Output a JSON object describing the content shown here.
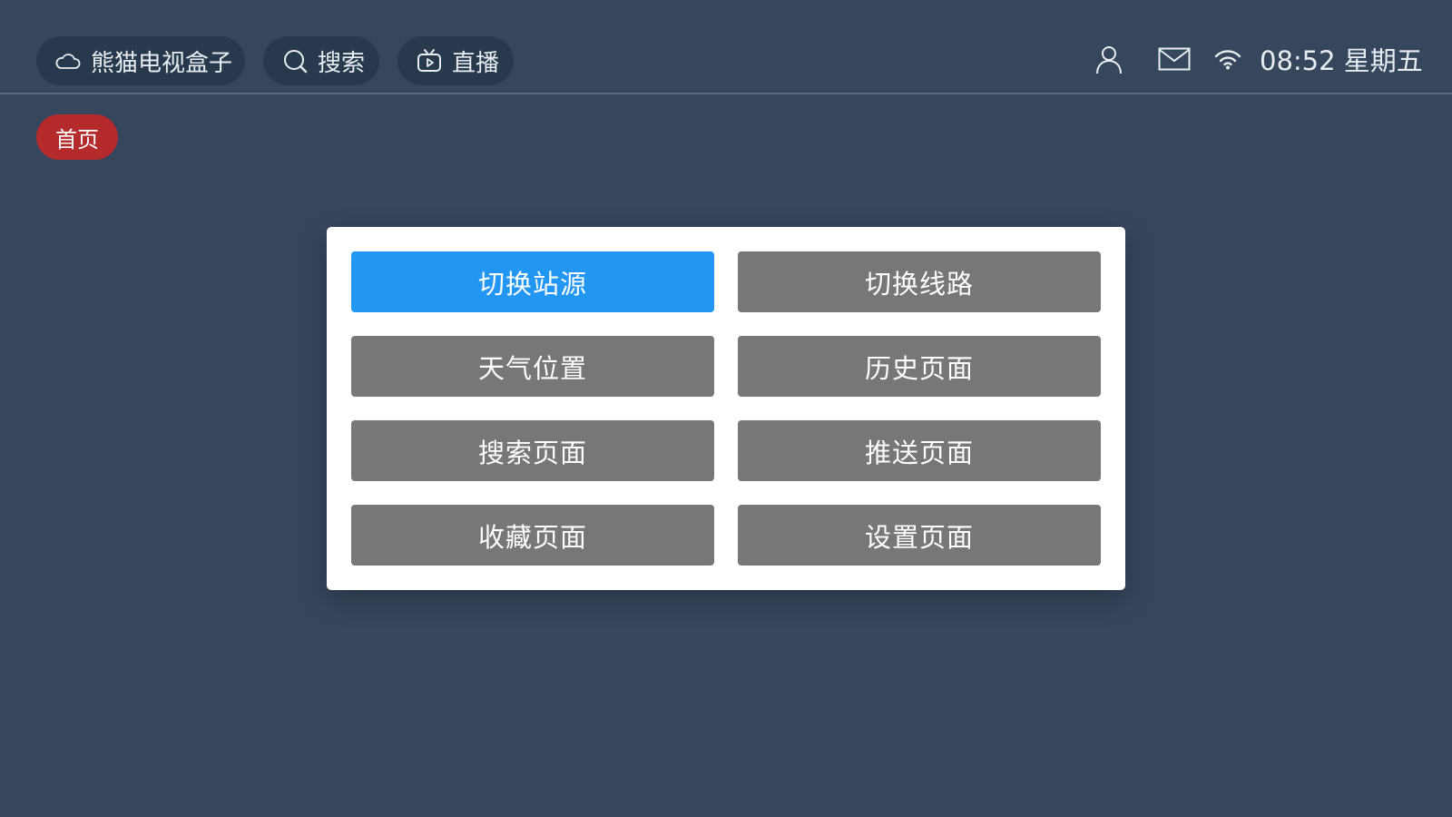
{
  "topbar": {
    "app_pill": {
      "icon": "cloud-icon",
      "label": "熊猫电视盒子"
    },
    "search_pill": {
      "icon": "search-icon",
      "label": "搜索"
    },
    "live_pill": {
      "icon": "tv-icon",
      "label": "直播"
    },
    "status": {
      "user_icon": "user-icon",
      "mail_icon": "mail-icon",
      "wifi_icon": "wifi-icon",
      "clock": "08:52 星期五"
    }
  },
  "tabs": {
    "home": {
      "label": "首页",
      "color": "#b52a2a"
    }
  },
  "dialog": {
    "buttons": [
      {
        "label": "切换站源",
        "selected": true
      },
      {
        "label": "切换线路",
        "selected": false
      },
      {
        "label": "天气位置",
        "selected": false
      },
      {
        "label": "历史页面",
        "selected": false
      },
      {
        "label": "搜索页面",
        "selected": false
      },
      {
        "label": "推送页面",
        "selected": false
      },
      {
        "label": "收藏页面",
        "selected": false
      },
      {
        "label": "设置页面",
        "selected": false
      }
    ]
  },
  "colors": {
    "background": "#36465c",
    "pill": "#28394d",
    "button_default": "#777777",
    "button_selected": "#2196f3"
  }
}
